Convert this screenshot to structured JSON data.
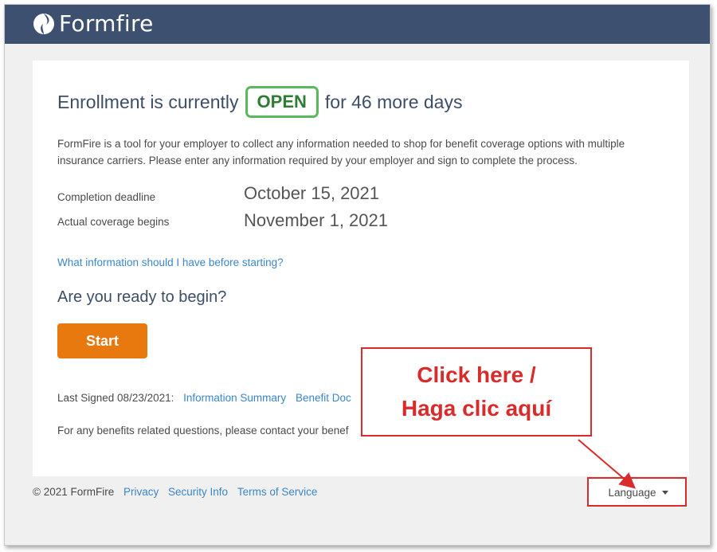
{
  "brand": {
    "name": "Formfire"
  },
  "enrollment": {
    "prefix": "Enrollment is currently",
    "status": "OPEN",
    "suffix": "for 46 more days"
  },
  "intro_text": "FormFire is a tool for your employer to collect any information needed to shop for benefit coverage options with multiple insurance carriers. Please enter any information required by your employer and sign to complete the process.",
  "dates": [
    {
      "label": "Completion deadline",
      "value": "October 15, 2021"
    },
    {
      "label": "Actual coverage begins",
      "value": "November 1, 2021"
    }
  ],
  "info_link": "What information should I have before starting?",
  "ready_prompt": "Are you ready to begin?",
  "start_label": "Start",
  "last_signed": {
    "label": "Last Signed 08/23/2021:",
    "links": [
      "Information Summary",
      "Benefit Doc"
    ]
  },
  "questions_text": "For any benefits related questions, please contact your benef",
  "footer": {
    "copyright": "© 2021 FormFire",
    "links": [
      "Privacy",
      "Security Info",
      "Terms of Service"
    ]
  },
  "language_label": "Language",
  "callout": {
    "line1": "Click here /",
    "line2": "Haga clic aquí"
  },
  "colors": {
    "header_bg": "#3d506f",
    "open_green": "#5cb85c",
    "start_orange": "#e8790f",
    "link_blue": "#3a87c9",
    "callout_red": "#d92b2b"
  }
}
